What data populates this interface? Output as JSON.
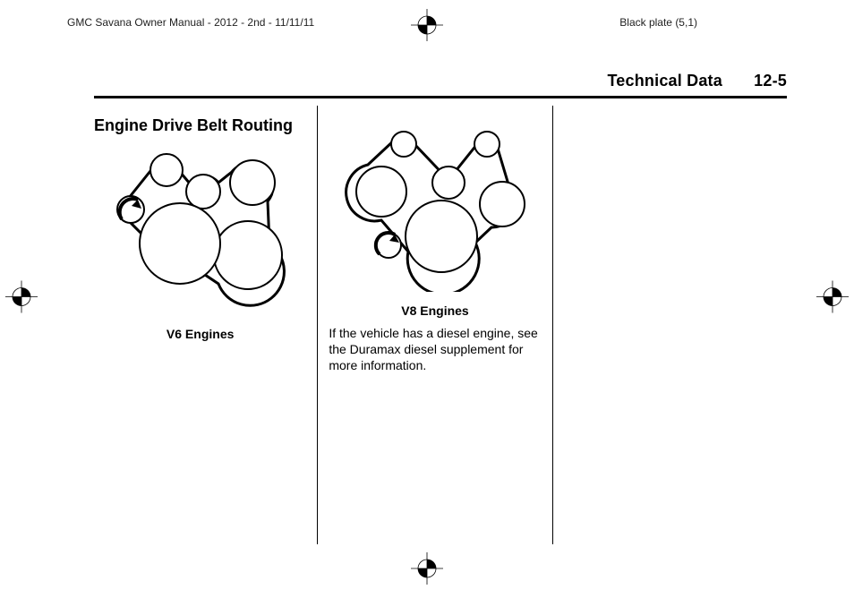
{
  "header": {
    "manual_id": "GMC Savana Owner Manual - 2012 - 2nd - 11/11/11",
    "plate": "Black plate (5,1)"
  },
  "section": {
    "title": "Technical Data",
    "page_number": "12-5"
  },
  "content": {
    "heading": "Engine Drive Belt Routing",
    "fig1_caption": "V6 Engines",
    "fig2_caption": "V8 Engines",
    "diesel_note": "If the vehicle has a diesel engine, see the Duramax diesel supplement for more information."
  }
}
